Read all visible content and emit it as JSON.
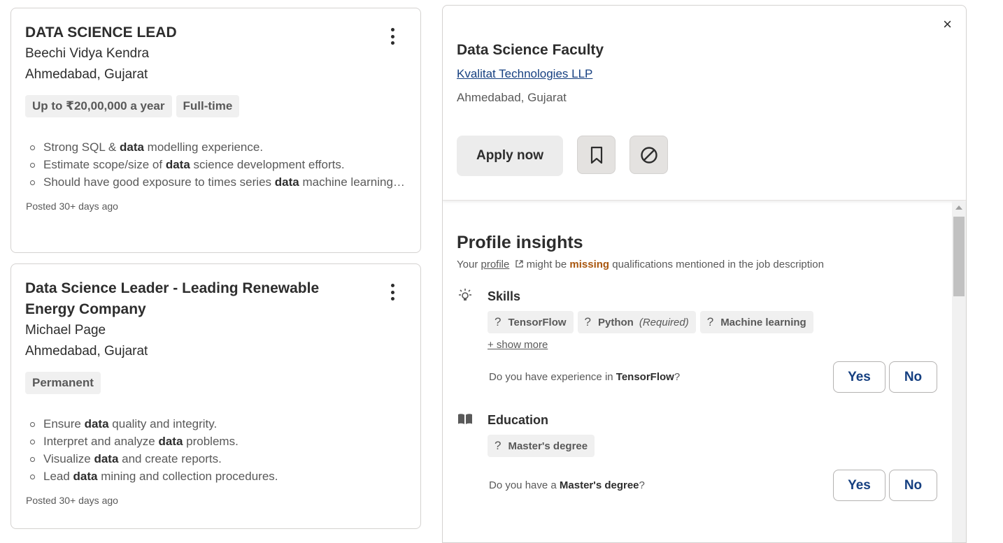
{
  "cards": [
    {
      "title": "DATA SCIENCE LEAD",
      "company": "Beechi Vidya Kendra",
      "location": "Ahmedabad, Gujarat",
      "tags": [
        "Up to ₹20,00,000 a year",
        "Full-time"
      ],
      "bullets": [
        [
          "Strong SQL & ",
          "data",
          " modelling experience."
        ],
        [
          "Estimate scope/size of ",
          "data",
          " science development efforts."
        ],
        [
          "Should have good exposure to times series ",
          "data",
          " machine learning…"
        ]
      ],
      "posted": "Posted 30+ days ago"
    },
    {
      "title": "Data Science Leader - Leading Renewable Energy Company",
      "company": "Michael Page",
      "location": "Ahmedabad, Gujarat",
      "tags": [
        "Permanent"
      ],
      "bullets": [
        [
          "Ensure ",
          "data",
          " quality and integrity."
        ],
        [
          "Interpret and analyze ",
          "data",
          " problems."
        ],
        [
          "Visualize ",
          "data",
          " and create reports."
        ],
        [
          "Lead ",
          "data",
          " mining and collection procedures."
        ]
      ],
      "posted": "Posted 30+ days ago"
    }
  ],
  "detail": {
    "close": "×",
    "title": "Data Science Faculty",
    "company": "Kvalitat Technologies LLP",
    "location": "Ahmedabad, Gujarat",
    "apply_label": "Apply now",
    "save_icon": "bookmark-icon",
    "not_interested_icon": "block-icon"
  },
  "insights": {
    "title": "Profile insights",
    "sub_prefix": "Your ",
    "sub_link": "profile",
    "sub_mid": " might be ",
    "sub_missing": "missing",
    "sub_suffix": " qualifications mentioned in the job description",
    "skills": {
      "label": "Skills",
      "icon": "lightbulb-icon",
      "chips": [
        {
          "q": "?",
          "name": "TensorFlow",
          "note": ""
        },
        {
          "q": "?",
          "name": "Python",
          "note": "(Required)"
        },
        {
          "q": "?",
          "name": "Machine learning",
          "note": ""
        }
      ],
      "show_more": "+ show more",
      "q_prefix": "Do you have experience in ",
      "q_bold": "TensorFlow",
      "q_suffix": "?",
      "yes": "Yes",
      "no": "No"
    },
    "education": {
      "label": "Education",
      "icon": "book-icon",
      "chips": [
        {
          "q": "?",
          "name": "Master's degree",
          "note": ""
        }
      ],
      "q_prefix": "Do you have a ",
      "q_bold": "Master's degree",
      "q_suffix": "?",
      "yes": "Yes",
      "no": "No"
    }
  },
  "colors": {
    "link": "#164081",
    "missing": "#a9570f",
    "tag_bg": "#f0f0f0"
  }
}
